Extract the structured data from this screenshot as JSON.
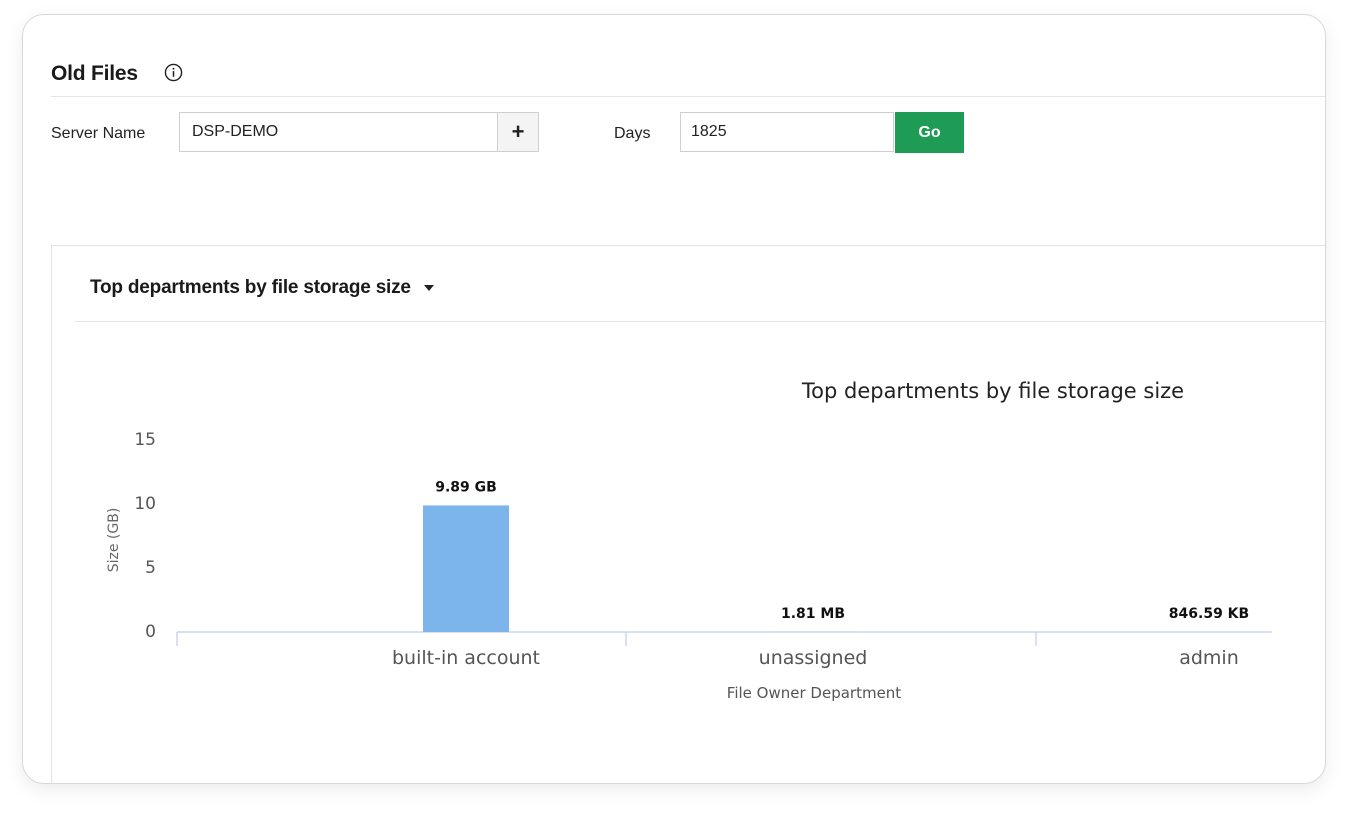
{
  "page": {
    "title": "Old Files",
    "info_icon": "info-circle-icon"
  },
  "filters": {
    "server_label": "Server Name",
    "server_value": "DSP-DEMO",
    "add_server_label": "+",
    "days_label": "Days",
    "days_value": "1825",
    "go_label": "Go",
    "go_color": "#1e9b55"
  },
  "report": {
    "selector_label": "Top departments by file storage size",
    "selector_icon": "caret-down-icon"
  },
  "chart_data": {
    "type": "bar",
    "title": "Top departments by file storage size",
    "xlabel": "File Owner Department",
    "ylabel": "Size (GB)",
    "ylim": [
      0,
      15
    ],
    "yticks": [
      0,
      5,
      10,
      15
    ],
    "categories": [
      "built-in account",
      "unassigned",
      "admin"
    ],
    "values": [
      9.89,
      0.00181,
      0.00085
    ],
    "data_labels": [
      "9.89 GB",
      "1.81 MB",
      "846.59 KB"
    ],
    "bar_color": "#7cb5ec",
    "grid": false
  }
}
